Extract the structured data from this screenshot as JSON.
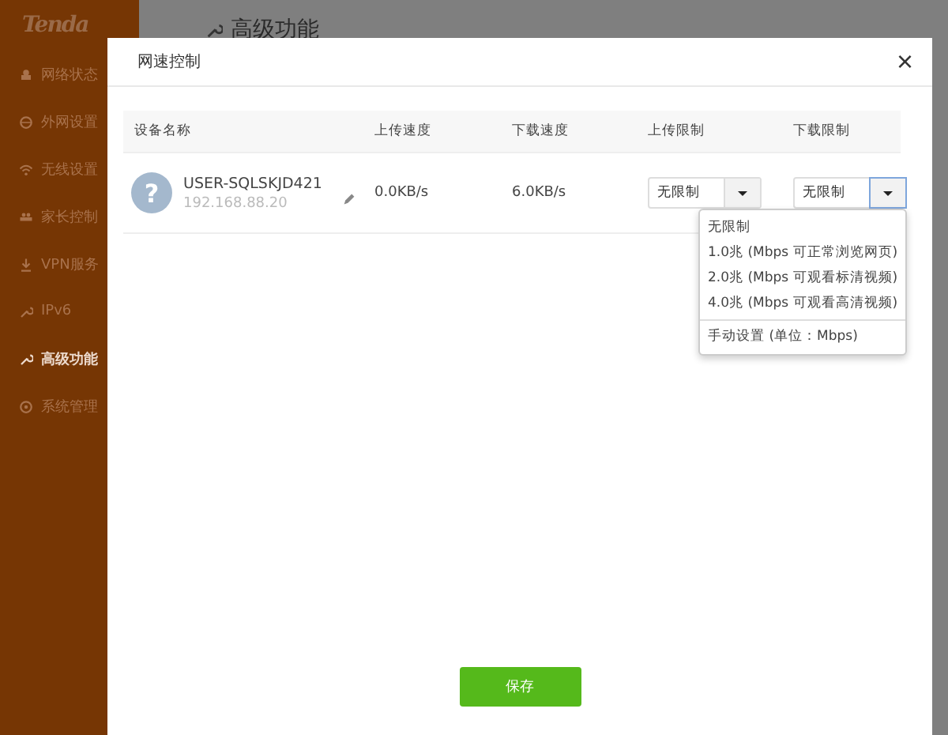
{
  "sidebar": {
    "logo": "Tenda",
    "items": [
      {
        "label": "网络状态",
        "selected": false
      },
      {
        "label": "外网设置",
        "selected": false
      },
      {
        "label": "无线设置",
        "selected": false
      },
      {
        "label": "家长控制",
        "selected": false
      },
      {
        "label": "VPN服务",
        "selected": false
      },
      {
        "label": "IPv6",
        "selected": false
      },
      {
        "label": "高级功能",
        "selected": true
      },
      {
        "label": "系统管理",
        "selected": false
      }
    ]
  },
  "page": {
    "title": "高级功能"
  },
  "dialog": {
    "title": "网速控制",
    "close": "×",
    "table": {
      "columns": [
        "设备名称",
        "上传速度",
        "下载速度",
        "上传限制",
        "下载限制"
      ],
      "rows": [
        {
          "avatar": "?",
          "name": "USER-SQLSKJD421",
          "ip": "192.168.88.20",
          "upload_speed": "0.0KB/s",
          "download_speed": "6.0KB/s",
          "upload_limit": {
            "value": "无限制",
            "expanded": false
          },
          "download_limit": {
            "value": "无限制",
            "expanded": true,
            "options": [
              {
                "label": "无限制",
                "divider_before": false
              },
              {
                "label": "1.0兆 (Mbps 可正常浏览网页)",
                "divider_before": false
              },
              {
                "label": "2.0兆 (Mbps 可观看标清视频)",
                "divider_before": false
              },
              {
                "label": "4.0兆 (Mbps 可观看高清视频)",
                "divider_before": false
              },
              {
                "label": "手动设置 (单位：Mbps)",
                "divider_before": true
              }
            ]
          }
        }
      ]
    },
    "save_button": "保存"
  }
}
